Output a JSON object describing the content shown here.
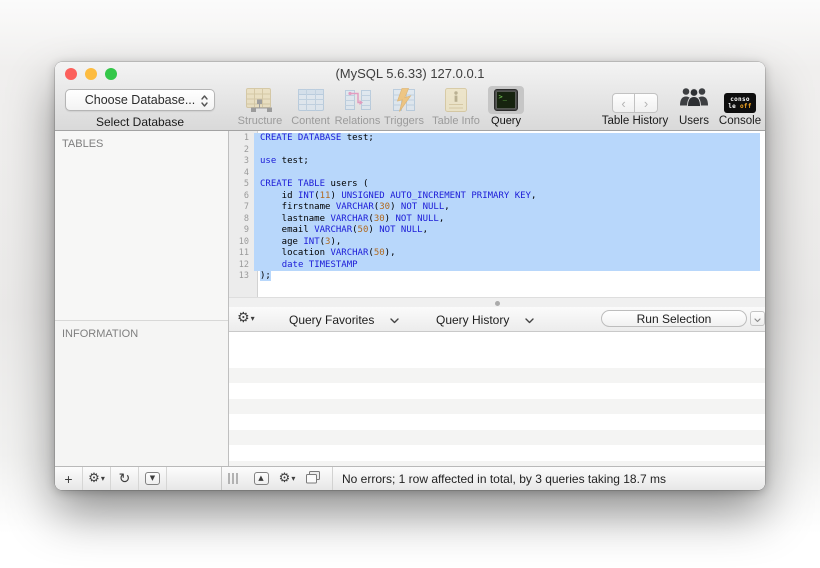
{
  "window": {
    "title": "(MySQL 5.6.33) 127.0.0.1"
  },
  "toolbar": {
    "database_dropdown": {
      "value": "Choose Database...",
      "caption": "Select Database"
    },
    "nav_items": [
      {
        "label": "Structure",
        "icon": "structure-table-icon",
        "enabled": false
      },
      {
        "label": "Content",
        "icon": "content-table-icon",
        "enabled": false
      },
      {
        "label": "Relations",
        "icon": "relations-icon",
        "enabled": false
      },
      {
        "label": "Triggers",
        "icon": "triggers-icon",
        "enabled": false
      },
      {
        "label": "Table Info",
        "icon": "table-info-icon",
        "enabled": false
      },
      {
        "label": "Query",
        "icon": "query-terminal-icon",
        "enabled": true,
        "selected": true
      }
    ],
    "table_history": {
      "label": "Table History",
      "back": "‹",
      "forward": "›"
    },
    "users_label": "Users",
    "console": {
      "label": "Console",
      "badge_line1": "conso",
      "badge_line2": "le",
      "badge_off": "off"
    }
  },
  "sidebar": {
    "tables_header": "TABLES",
    "information_header": "INFORMATION"
  },
  "editor": {
    "lines": [
      {
        "n": 1,
        "sel": "full",
        "segments": [
          {
            "c": "kw",
            "t": "CREATE DATABASE"
          },
          {
            "c": "p",
            "t": " test;"
          }
        ]
      },
      {
        "n": 2,
        "sel": "full",
        "segments": []
      },
      {
        "n": 3,
        "sel": "full",
        "segments": [
          {
            "c": "kw",
            "t": "use"
          },
          {
            "c": "p",
            "t": " test;"
          }
        ]
      },
      {
        "n": 4,
        "sel": "full",
        "segments": []
      },
      {
        "n": 5,
        "sel": "full",
        "segments": [
          {
            "c": "kw",
            "t": "CREATE TABLE"
          },
          {
            "c": "p",
            "t": " users ("
          }
        ]
      },
      {
        "n": 6,
        "sel": "full",
        "segments": [
          {
            "c": "p",
            "t": "    id "
          },
          {
            "c": "kw",
            "t": "INT"
          },
          {
            "c": "p",
            "t": "("
          },
          {
            "c": "num",
            "t": "11"
          },
          {
            "c": "p",
            "t": ") "
          },
          {
            "c": "kw",
            "t": "UNSIGNED AUTO_INCREMENT PRIMARY KEY"
          },
          {
            "c": "p",
            "t": ","
          }
        ]
      },
      {
        "n": 7,
        "sel": "full",
        "segments": [
          {
            "c": "p",
            "t": "    firstname "
          },
          {
            "c": "kw",
            "t": "VARCHAR"
          },
          {
            "c": "p",
            "t": "("
          },
          {
            "c": "num",
            "t": "30"
          },
          {
            "c": "p",
            "t": ") "
          },
          {
            "c": "kw",
            "t": "NOT NULL"
          },
          {
            "c": "p",
            "t": ","
          }
        ]
      },
      {
        "n": 8,
        "sel": "full",
        "segments": [
          {
            "c": "p",
            "t": "    lastname "
          },
          {
            "c": "kw",
            "t": "VARCHAR"
          },
          {
            "c": "p",
            "t": "("
          },
          {
            "c": "num",
            "t": "30"
          },
          {
            "c": "p",
            "t": ") "
          },
          {
            "c": "kw",
            "t": "NOT NULL"
          },
          {
            "c": "p",
            "t": ","
          }
        ]
      },
      {
        "n": 9,
        "sel": "full",
        "segments": [
          {
            "c": "p",
            "t": "    email "
          },
          {
            "c": "kw",
            "t": "VARCHAR"
          },
          {
            "c": "p",
            "t": "("
          },
          {
            "c": "num",
            "t": "50"
          },
          {
            "c": "p",
            "t": ") "
          },
          {
            "c": "kw",
            "t": "NOT NULL"
          },
          {
            "c": "p",
            "t": ","
          }
        ]
      },
      {
        "n": 10,
        "sel": "full",
        "segments": [
          {
            "c": "p",
            "t": "    age "
          },
          {
            "c": "kw",
            "t": "INT"
          },
          {
            "c": "p",
            "t": "("
          },
          {
            "c": "num",
            "t": "3"
          },
          {
            "c": "p",
            "t": "),"
          }
        ]
      },
      {
        "n": 11,
        "sel": "full",
        "segments": [
          {
            "c": "p",
            "t": "    location "
          },
          {
            "c": "kw",
            "t": "VARCHAR"
          },
          {
            "c": "p",
            "t": "("
          },
          {
            "c": "num",
            "t": "50"
          },
          {
            "c": "p",
            "t": "),"
          }
        ]
      },
      {
        "n": 12,
        "sel": "full",
        "segments": [
          {
            "c": "p",
            "t": "    "
          },
          {
            "c": "kw",
            "t": "date TIMESTAMP"
          }
        ]
      },
      {
        "n": 13,
        "sel": "text",
        "segments": [
          {
            "c": "p",
            "t": ");"
          }
        ]
      }
    ]
  },
  "query_bar": {
    "favorites": "Query Favorites",
    "history": "Query History",
    "run_button": "Run Selection"
  },
  "status_bar": {
    "message": "No errors; 1 row affected in total, by 3 queries taking 18.7 ms"
  },
  "colors": {
    "keyword": "#1b1bd7",
    "number": "#b06a20",
    "selection": "#b8d7fb",
    "traffic_close": "#fc605c",
    "traffic_minimize": "#fdbc40",
    "traffic_zoom": "#34c749",
    "selected_tab_background": "#c6c6c6",
    "console_off_badge": "#f5a623"
  }
}
